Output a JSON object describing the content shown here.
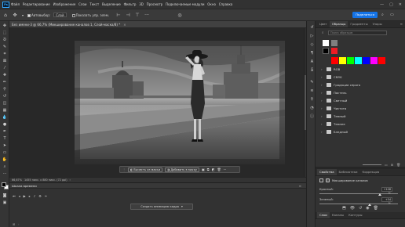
{
  "menubar": {
    "logo": "Ps",
    "items": [
      "Файл",
      "Редактирование",
      "Изображение",
      "Слои",
      "Текст",
      "Выделение",
      "Фильтр",
      "3D",
      "Просмотр",
      "Подключаемые модули",
      "Окно",
      "Справка"
    ]
  },
  "options": {
    "autoselect_label": "Автовыбор:",
    "layer_select": "Слой",
    "show_transform_label": "Показать упр. элем."
  },
  "share_label": "Поделиться",
  "document": {
    "tab_title": "Без имени-3 @ 66,7% (Микширование каналов 1, Слой-маска/8) *"
  },
  "status": {
    "zoom": "66,67%",
    "dimensions": "1455 пикс. x 880 пикс. (72 ppi)"
  },
  "context_bar": {
    "invert": "Вычесть из маски",
    "add": "Добавить в маску"
  },
  "timeline": {
    "title": "Шкала времени",
    "create": "Создать анимацию кадра"
  },
  "swatches": {
    "tabs": [
      "Цвет",
      "Образцы",
      "Градиенты",
      "Узоры"
    ],
    "search_placeholder": "Поиск образцов",
    "recent_colors": [
      "#ffffff",
      "#000000",
      "#7f7f7f",
      "#ed1c24"
    ],
    "palette": [
      "#ff0000",
      "#ffff00",
      "#00ff00",
      "#00ffff",
      "#0000ff",
      "#ff00ff",
      "#ff0000"
    ],
    "groups": [
      "RGB",
      "CMYK",
      "Градации серого",
      "Пастель",
      "Светлый",
      "Чистота",
      "Темный",
      "Темнее",
      "Бледный"
    ]
  },
  "properties": {
    "tabs": [
      "Свойства",
      "Библиотеки",
      "Коррекция"
    ],
    "header": "Микширование каналов",
    "preset_label": "Набор:",
    "channel_label": "Выходной канал:",
    "mono_label": "Монохромный",
    "rows": [
      {
        "label": "Красный:",
        "value": "+108 %",
        "level": 0.77
      },
      {
        "label": "Зеленый:",
        "value": "+54 %",
        "level": 0.64
      },
      {
        "label": "Синий:",
        "value": "-41 %",
        "level": 0.4
      },
      {
        "label": "Итого:",
        "value": "+121 %",
        "level": 0.8
      },
      {
        "label": "Константа:",
        "value": "+0 %",
        "level": 0.5
      }
    ]
  },
  "bottom_tabs": [
    "Слои",
    "Каналы",
    "Контуры"
  ]
}
